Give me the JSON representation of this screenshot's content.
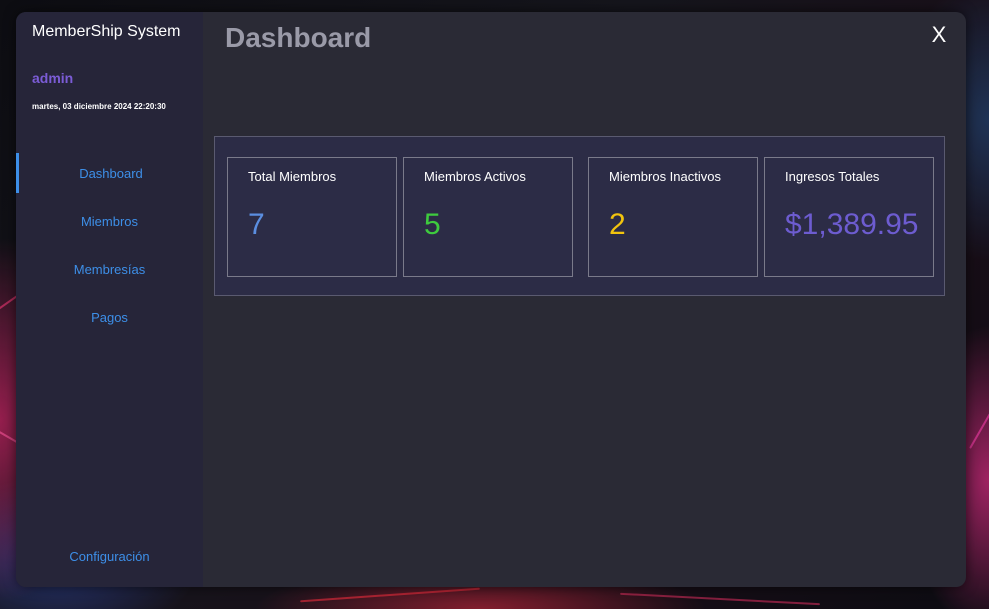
{
  "sidebar": {
    "app_title": "MemberShip System",
    "user": "admin",
    "datetime": "martes, 03 diciembre 2024 22:20:30",
    "nav": [
      {
        "label": "Dashboard"
      },
      {
        "label": "Miembros"
      },
      {
        "label": "Membresías"
      },
      {
        "label": "Pagos"
      }
    ],
    "settings_label": "Configuración"
  },
  "header": {
    "title": "Dashboard",
    "close_label": "X"
  },
  "cards": [
    {
      "label": "Total Miembros",
      "value": "7",
      "color": "#5b8ee0"
    },
    {
      "label": "Miembros Activos",
      "value": "5",
      "color": "#3ecb3e"
    },
    {
      "label": "Miembros Inactivos",
      "value": "2",
      "color": "#f2c40e"
    },
    {
      "label": "Ingresos Totales",
      "value": "$1,389.95",
      "color": "#6d5cd0"
    }
  ],
  "colors": {
    "accent": "#3d8fe8",
    "user": "#7b5cd6",
    "window_bg": "#2a2a35",
    "sidebar_bg": "#262539"
  }
}
